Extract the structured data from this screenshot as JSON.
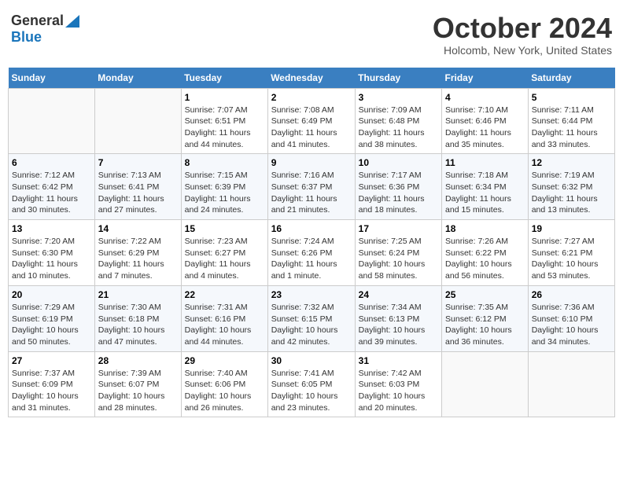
{
  "header": {
    "logo_general": "General",
    "logo_blue": "Blue",
    "title": "October 2024",
    "location": "Holcomb, New York, United States"
  },
  "days_of_week": [
    "Sunday",
    "Monday",
    "Tuesday",
    "Wednesday",
    "Thursday",
    "Friday",
    "Saturday"
  ],
  "weeks": [
    [
      {
        "day": "",
        "sunrise": "",
        "sunset": "",
        "daylight": ""
      },
      {
        "day": "",
        "sunrise": "",
        "sunset": "",
        "daylight": ""
      },
      {
        "day": "1",
        "sunrise": "Sunrise: 7:07 AM",
        "sunset": "Sunset: 6:51 PM",
        "daylight": "Daylight: 11 hours and 44 minutes."
      },
      {
        "day": "2",
        "sunrise": "Sunrise: 7:08 AM",
        "sunset": "Sunset: 6:49 PM",
        "daylight": "Daylight: 11 hours and 41 minutes."
      },
      {
        "day": "3",
        "sunrise": "Sunrise: 7:09 AM",
        "sunset": "Sunset: 6:48 PM",
        "daylight": "Daylight: 11 hours and 38 minutes."
      },
      {
        "day": "4",
        "sunrise": "Sunrise: 7:10 AM",
        "sunset": "Sunset: 6:46 PM",
        "daylight": "Daylight: 11 hours and 35 minutes."
      },
      {
        "day": "5",
        "sunrise": "Sunrise: 7:11 AM",
        "sunset": "Sunset: 6:44 PM",
        "daylight": "Daylight: 11 hours and 33 minutes."
      }
    ],
    [
      {
        "day": "6",
        "sunrise": "Sunrise: 7:12 AM",
        "sunset": "Sunset: 6:42 PM",
        "daylight": "Daylight: 11 hours and 30 minutes."
      },
      {
        "day": "7",
        "sunrise": "Sunrise: 7:13 AM",
        "sunset": "Sunset: 6:41 PM",
        "daylight": "Daylight: 11 hours and 27 minutes."
      },
      {
        "day": "8",
        "sunrise": "Sunrise: 7:15 AM",
        "sunset": "Sunset: 6:39 PM",
        "daylight": "Daylight: 11 hours and 24 minutes."
      },
      {
        "day": "9",
        "sunrise": "Sunrise: 7:16 AM",
        "sunset": "Sunset: 6:37 PM",
        "daylight": "Daylight: 11 hours and 21 minutes."
      },
      {
        "day": "10",
        "sunrise": "Sunrise: 7:17 AM",
        "sunset": "Sunset: 6:36 PM",
        "daylight": "Daylight: 11 hours and 18 minutes."
      },
      {
        "day": "11",
        "sunrise": "Sunrise: 7:18 AM",
        "sunset": "Sunset: 6:34 PM",
        "daylight": "Daylight: 11 hours and 15 minutes."
      },
      {
        "day": "12",
        "sunrise": "Sunrise: 7:19 AM",
        "sunset": "Sunset: 6:32 PM",
        "daylight": "Daylight: 11 hours and 13 minutes."
      }
    ],
    [
      {
        "day": "13",
        "sunrise": "Sunrise: 7:20 AM",
        "sunset": "Sunset: 6:30 PM",
        "daylight": "Daylight: 11 hours and 10 minutes."
      },
      {
        "day": "14",
        "sunrise": "Sunrise: 7:22 AM",
        "sunset": "Sunset: 6:29 PM",
        "daylight": "Daylight: 11 hours and 7 minutes."
      },
      {
        "day": "15",
        "sunrise": "Sunrise: 7:23 AM",
        "sunset": "Sunset: 6:27 PM",
        "daylight": "Daylight: 11 hours and 4 minutes."
      },
      {
        "day": "16",
        "sunrise": "Sunrise: 7:24 AM",
        "sunset": "Sunset: 6:26 PM",
        "daylight": "Daylight: 11 hours and 1 minute."
      },
      {
        "day": "17",
        "sunrise": "Sunrise: 7:25 AM",
        "sunset": "Sunset: 6:24 PM",
        "daylight": "Daylight: 10 hours and 58 minutes."
      },
      {
        "day": "18",
        "sunrise": "Sunrise: 7:26 AM",
        "sunset": "Sunset: 6:22 PM",
        "daylight": "Daylight: 10 hours and 56 minutes."
      },
      {
        "day": "19",
        "sunrise": "Sunrise: 7:27 AM",
        "sunset": "Sunset: 6:21 PM",
        "daylight": "Daylight: 10 hours and 53 minutes."
      }
    ],
    [
      {
        "day": "20",
        "sunrise": "Sunrise: 7:29 AM",
        "sunset": "Sunset: 6:19 PM",
        "daylight": "Daylight: 10 hours and 50 minutes."
      },
      {
        "day": "21",
        "sunrise": "Sunrise: 7:30 AM",
        "sunset": "Sunset: 6:18 PM",
        "daylight": "Daylight: 10 hours and 47 minutes."
      },
      {
        "day": "22",
        "sunrise": "Sunrise: 7:31 AM",
        "sunset": "Sunset: 6:16 PM",
        "daylight": "Daylight: 10 hours and 44 minutes."
      },
      {
        "day": "23",
        "sunrise": "Sunrise: 7:32 AM",
        "sunset": "Sunset: 6:15 PM",
        "daylight": "Daylight: 10 hours and 42 minutes."
      },
      {
        "day": "24",
        "sunrise": "Sunrise: 7:34 AM",
        "sunset": "Sunset: 6:13 PM",
        "daylight": "Daylight: 10 hours and 39 minutes."
      },
      {
        "day": "25",
        "sunrise": "Sunrise: 7:35 AM",
        "sunset": "Sunset: 6:12 PM",
        "daylight": "Daylight: 10 hours and 36 minutes."
      },
      {
        "day": "26",
        "sunrise": "Sunrise: 7:36 AM",
        "sunset": "Sunset: 6:10 PM",
        "daylight": "Daylight: 10 hours and 34 minutes."
      }
    ],
    [
      {
        "day": "27",
        "sunrise": "Sunrise: 7:37 AM",
        "sunset": "Sunset: 6:09 PM",
        "daylight": "Daylight: 10 hours and 31 minutes."
      },
      {
        "day": "28",
        "sunrise": "Sunrise: 7:39 AM",
        "sunset": "Sunset: 6:07 PM",
        "daylight": "Daylight: 10 hours and 28 minutes."
      },
      {
        "day": "29",
        "sunrise": "Sunrise: 7:40 AM",
        "sunset": "Sunset: 6:06 PM",
        "daylight": "Daylight: 10 hours and 26 minutes."
      },
      {
        "day": "30",
        "sunrise": "Sunrise: 7:41 AM",
        "sunset": "Sunset: 6:05 PM",
        "daylight": "Daylight: 10 hours and 23 minutes."
      },
      {
        "day": "31",
        "sunrise": "Sunrise: 7:42 AM",
        "sunset": "Sunset: 6:03 PM",
        "daylight": "Daylight: 10 hours and 20 minutes."
      },
      {
        "day": "",
        "sunrise": "",
        "sunset": "",
        "daylight": ""
      },
      {
        "day": "",
        "sunrise": "",
        "sunset": "",
        "daylight": ""
      }
    ]
  ]
}
